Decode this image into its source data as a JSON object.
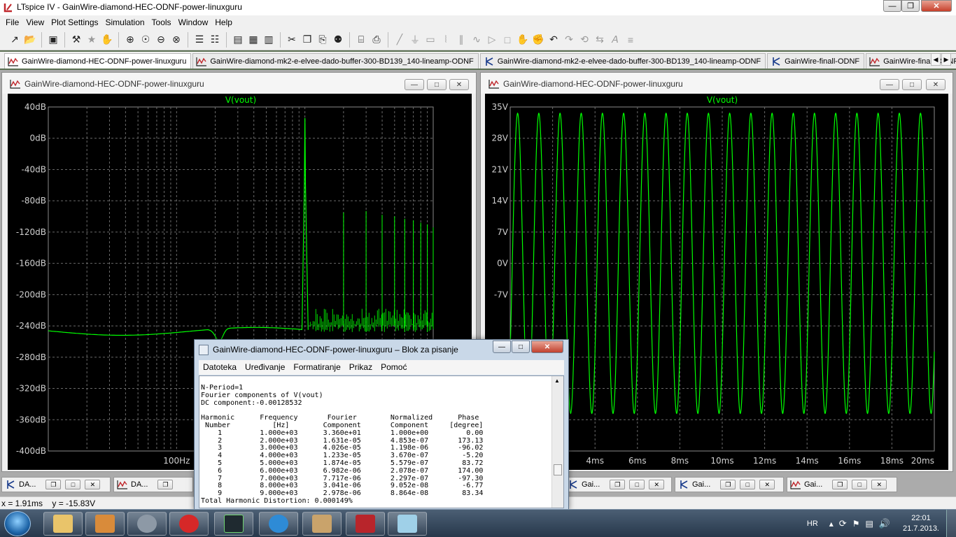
{
  "app": {
    "title": "LTspice IV - GainWire-diamond-HEC-ODNF-power-linuxguru",
    "window_buttons": {
      "minimize": "—",
      "maximize": "❐",
      "close": "✕"
    }
  },
  "menu": [
    "File",
    "View",
    "Plot Settings",
    "Simulation",
    "Tools",
    "Window",
    "Help"
  ],
  "doc_tabs": [
    {
      "label": "GainWire-diamond-HEC-ODNF-power-linuxguru",
      "icon": "waveform-icon",
      "active": true
    },
    {
      "label": "GainWire-diamond-mk2-e-elvee-dado-buffer-300-BD139_140-lineamp-ODNF",
      "icon": "waveform-icon",
      "active": false
    },
    {
      "label": "GainWire-diamond-mk2-e-elvee-dado-buffer-300-BD139_140-lineamp-ODNF",
      "icon": "schematic-icon",
      "active": false
    },
    {
      "label": "GainWire-finall-ODNF",
      "icon": "schematic-icon",
      "active": false
    },
    {
      "label": "GainWire-finall-ODNF",
      "icon": "waveform-icon",
      "active": false
    }
  ],
  "plot_left": {
    "window_title": "GainWire-diamond-HEC-ODNF-power-linuxguru",
    "trace_label": "V(vout)",
    "trace_color": "#00ff00",
    "y_ticks": [
      "40dB",
      "0dB",
      "-40dB",
      "-80dB",
      "-120dB",
      "-160dB",
      "-200dB",
      "-240dB",
      "-280dB",
      "-320dB",
      "-360dB",
      "-400dB"
    ],
    "x_ticks": [
      "100Hz"
    ]
  },
  "plot_right": {
    "window_title": "GainWire-diamond-HEC-ODNF-power-linuxguru",
    "trace_label": "V(vout)",
    "trace_color": "#00ff00",
    "y_ticks": [
      "35V",
      "28V",
      "21V",
      "14V",
      "7V",
      "0V",
      "-7V"
    ],
    "x_ticks": [
      "4ms",
      "6ms",
      "8ms",
      "10ms",
      "12ms",
      "14ms",
      "16ms",
      "18ms",
      "20ms"
    ]
  },
  "minimized_windows": [
    {
      "label": "DA...",
      "icon": "schematic-icon"
    },
    {
      "label": "DA...",
      "icon": "waveform-icon"
    },
    {
      "label": "Gai...",
      "icon": "schematic-icon"
    },
    {
      "label": "Gai...",
      "icon": "schematic-icon"
    },
    {
      "label": "Gai...",
      "icon": "waveform-icon"
    }
  ],
  "status": {
    "cursor": "x = 1.91ms    y = -15.83V"
  },
  "notepad": {
    "title": "GainWire-diamond-HEC-ODNF-power-linuxguru – Blok za pisanje",
    "menu": [
      "Datoteka",
      "Uređivanje",
      "Formatiranje",
      "Prikaz",
      "Pomoć"
    ],
    "lines": [
      "N-Period=1",
      "Fourier components of V(vout)",
      "DC component:-0.00128532",
      "",
      "Harmonic      Frequency       Fourier        Normalized      Phase",
      " Number          [Hz]        Component       Component     [degree]",
      "    1         1.000e+03      3.360e+01       1.000e+00         0.00",
      "    2         2.000e+03      1.631e-05       4.853e-07       173.13",
      "    3         3.000e+03      4.026e-05       1.198e-06       -96.02",
      "    4         4.000e+03      1.233e-05       3.670e-07        -5.20",
      "    5         5.000e+03      1.874e-05       5.579e-07        83.72",
      "    6         6.000e+03      6.982e-06       2.078e-07       174.00",
      "    7         7.000e+03      7.717e-06       2.297e-07       -97.30",
      "    8         8.000e+03      3.041e-06       9.052e-08        -6.77",
      "    9         9.000e+03      2.978e-06       8.864e-08        83.34",
      "Total Harmonic Distortion: 0.000149%"
    ]
  },
  "taskbar": {
    "apps": [
      "explorer-icon",
      "installer-icon",
      "tool-icon",
      "opera-icon",
      "ltspice-icon",
      "ie-icon",
      "mail-icon",
      "ltspice-shield-icon",
      "notepad-icon"
    ],
    "language": "HR",
    "time": "22:01",
    "date": "21.7.2013."
  }
}
